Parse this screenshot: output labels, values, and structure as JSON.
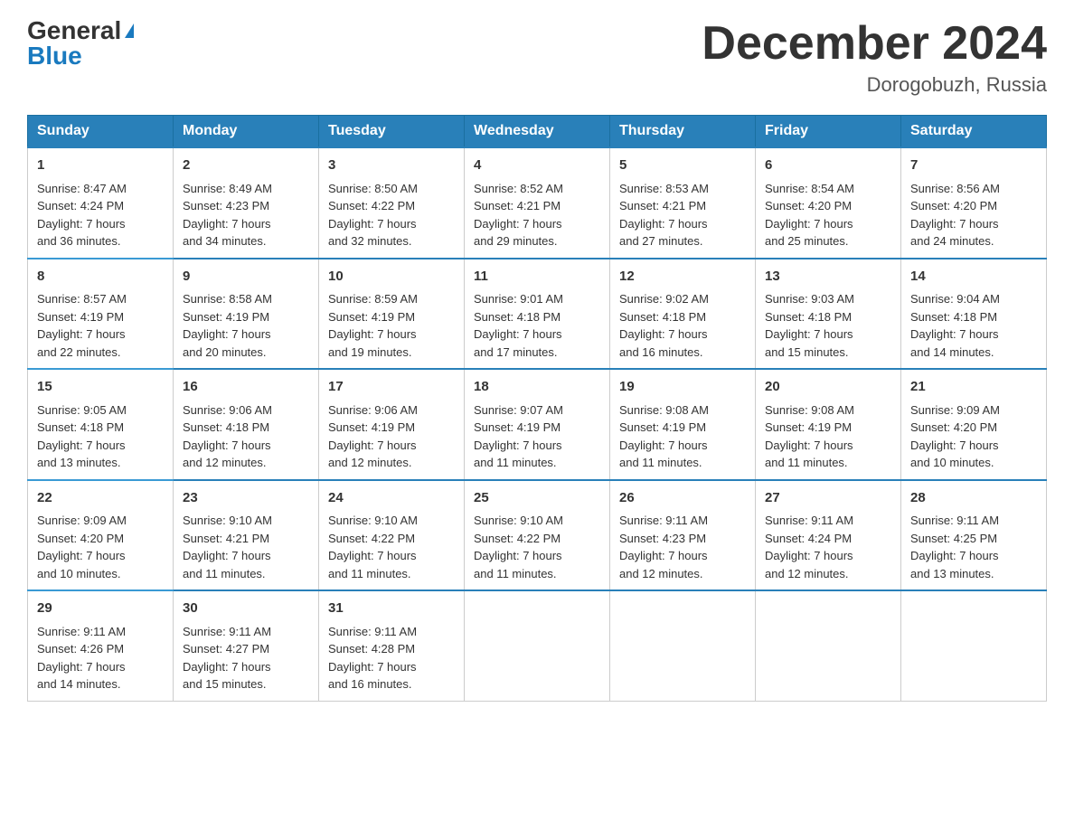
{
  "header": {
    "logo_general": "General",
    "logo_blue": "Blue",
    "month_title": "December 2024",
    "location": "Dorogobuzh, Russia"
  },
  "days_of_week": [
    "Sunday",
    "Monday",
    "Tuesday",
    "Wednesday",
    "Thursday",
    "Friday",
    "Saturday"
  ],
  "weeks": [
    [
      {
        "day": "1",
        "sunrise": "8:47 AM",
        "sunset": "4:24 PM",
        "daylight": "7 hours and 36 minutes."
      },
      {
        "day": "2",
        "sunrise": "8:49 AM",
        "sunset": "4:23 PM",
        "daylight": "7 hours and 34 minutes."
      },
      {
        "day": "3",
        "sunrise": "8:50 AM",
        "sunset": "4:22 PM",
        "daylight": "7 hours and 32 minutes."
      },
      {
        "day": "4",
        "sunrise": "8:52 AM",
        "sunset": "4:21 PM",
        "daylight": "7 hours and 29 minutes."
      },
      {
        "day": "5",
        "sunrise": "8:53 AM",
        "sunset": "4:21 PM",
        "daylight": "7 hours and 27 minutes."
      },
      {
        "day": "6",
        "sunrise": "8:54 AM",
        "sunset": "4:20 PM",
        "daylight": "7 hours and 25 minutes."
      },
      {
        "day": "7",
        "sunrise": "8:56 AM",
        "sunset": "4:20 PM",
        "daylight": "7 hours and 24 minutes."
      }
    ],
    [
      {
        "day": "8",
        "sunrise": "8:57 AM",
        "sunset": "4:19 PM",
        "daylight": "7 hours and 22 minutes."
      },
      {
        "day": "9",
        "sunrise": "8:58 AM",
        "sunset": "4:19 PM",
        "daylight": "7 hours and 20 minutes."
      },
      {
        "day": "10",
        "sunrise": "8:59 AM",
        "sunset": "4:19 PM",
        "daylight": "7 hours and 19 minutes."
      },
      {
        "day": "11",
        "sunrise": "9:01 AM",
        "sunset": "4:18 PM",
        "daylight": "7 hours and 17 minutes."
      },
      {
        "day": "12",
        "sunrise": "9:02 AM",
        "sunset": "4:18 PM",
        "daylight": "7 hours and 16 minutes."
      },
      {
        "day": "13",
        "sunrise": "9:03 AM",
        "sunset": "4:18 PM",
        "daylight": "7 hours and 15 minutes."
      },
      {
        "day": "14",
        "sunrise": "9:04 AM",
        "sunset": "4:18 PM",
        "daylight": "7 hours and 14 minutes."
      }
    ],
    [
      {
        "day": "15",
        "sunrise": "9:05 AM",
        "sunset": "4:18 PM",
        "daylight": "7 hours and 13 minutes."
      },
      {
        "day": "16",
        "sunrise": "9:06 AM",
        "sunset": "4:18 PM",
        "daylight": "7 hours and 12 minutes."
      },
      {
        "day": "17",
        "sunrise": "9:06 AM",
        "sunset": "4:19 PM",
        "daylight": "7 hours and 12 minutes."
      },
      {
        "day": "18",
        "sunrise": "9:07 AM",
        "sunset": "4:19 PM",
        "daylight": "7 hours and 11 minutes."
      },
      {
        "day": "19",
        "sunrise": "9:08 AM",
        "sunset": "4:19 PM",
        "daylight": "7 hours and 11 minutes."
      },
      {
        "day": "20",
        "sunrise": "9:08 AM",
        "sunset": "4:19 PM",
        "daylight": "7 hours and 11 minutes."
      },
      {
        "day": "21",
        "sunrise": "9:09 AM",
        "sunset": "4:20 PM",
        "daylight": "7 hours and 10 minutes."
      }
    ],
    [
      {
        "day": "22",
        "sunrise": "9:09 AM",
        "sunset": "4:20 PM",
        "daylight": "7 hours and 10 minutes."
      },
      {
        "day": "23",
        "sunrise": "9:10 AM",
        "sunset": "4:21 PM",
        "daylight": "7 hours and 11 minutes."
      },
      {
        "day": "24",
        "sunrise": "9:10 AM",
        "sunset": "4:22 PM",
        "daylight": "7 hours and 11 minutes."
      },
      {
        "day": "25",
        "sunrise": "9:10 AM",
        "sunset": "4:22 PM",
        "daylight": "7 hours and 11 minutes."
      },
      {
        "day": "26",
        "sunrise": "9:11 AM",
        "sunset": "4:23 PM",
        "daylight": "7 hours and 12 minutes."
      },
      {
        "day": "27",
        "sunrise": "9:11 AM",
        "sunset": "4:24 PM",
        "daylight": "7 hours and 12 minutes."
      },
      {
        "day": "28",
        "sunrise": "9:11 AM",
        "sunset": "4:25 PM",
        "daylight": "7 hours and 13 minutes."
      }
    ],
    [
      {
        "day": "29",
        "sunrise": "9:11 AM",
        "sunset": "4:26 PM",
        "daylight": "7 hours and 14 minutes."
      },
      {
        "day": "30",
        "sunrise": "9:11 AM",
        "sunset": "4:27 PM",
        "daylight": "7 hours and 15 minutes."
      },
      {
        "day": "31",
        "sunrise": "9:11 AM",
        "sunset": "4:28 PM",
        "daylight": "7 hours and 16 minutes."
      },
      null,
      null,
      null,
      null
    ]
  ],
  "labels": {
    "sunrise": "Sunrise:",
    "sunset": "Sunset:",
    "daylight": "Daylight:"
  }
}
